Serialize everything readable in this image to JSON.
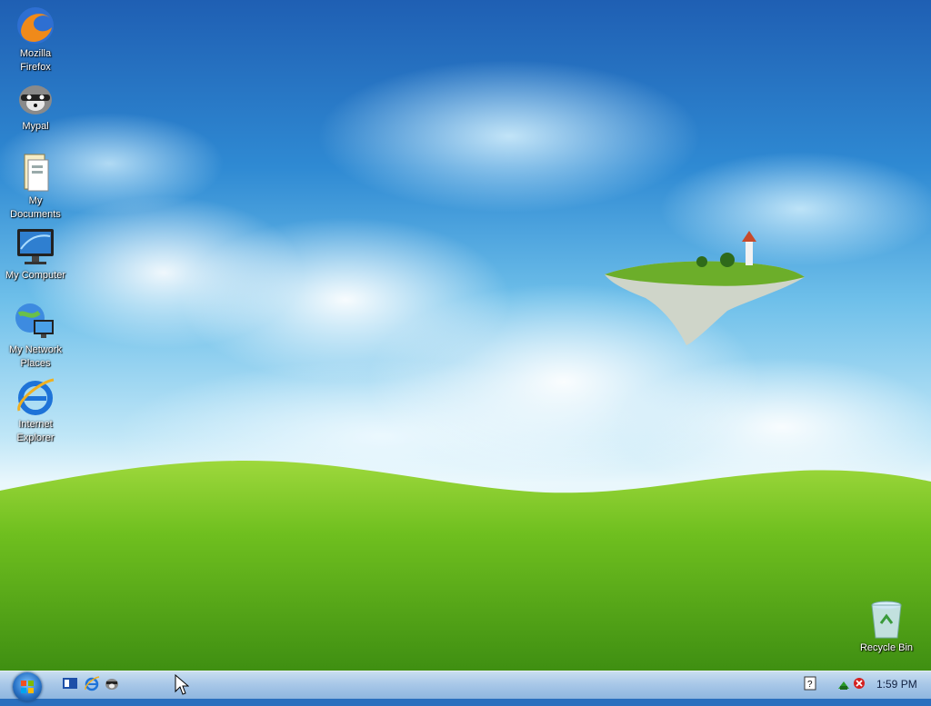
{
  "desktop": {
    "icons": [
      {
        "label_line1": "Mozilla",
        "label_line2": "Firefox",
        "icon": "firefox-icon"
      },
      {
        "label_line1": "Mypal",
        "label_line2": "",
        "icon": "mypal-icon"
      },
      {
        "label_line1": "My",
        "label_line2": "Documents",
        "icon": "my-documents-icon"
      },
      {
        "label_line1": "My Computer",
        "label_line2": "",
        "icon": "my-computer-icon"
      },
      {
        "label_line1": "My Network",
        "label_line2": "Places",
        "icon": "my-network-places-icon"
      },
      {
        "label_line1": "Internet",
        "label_line2": "Explorer",
        "icon": "internet-explorer-icon"
      },
      {
        "label_line1": "Recycle Bin",
        "label_line2": "",
        "icon": "recycle-bin-icon"
      }
    ]
  },
  "taskbar": {
    "start_icon": "windows-start-orb-icon",
    "quick_launch": [
      "show-desktop-icon",
      "internet-explorer-icon",
      "mypal-icon"
    ],
    "tray_icons": [
      "help-icon",
      "network-icon",
      "security-alert-icon"
    ],
    "clock": "1:59 PM"
  },
  "colors": {
    "sky_top": "#1f5fb3",
    "grass": "#5aa81e",
    "taskbar": "#a9c8e8"
  }
}
